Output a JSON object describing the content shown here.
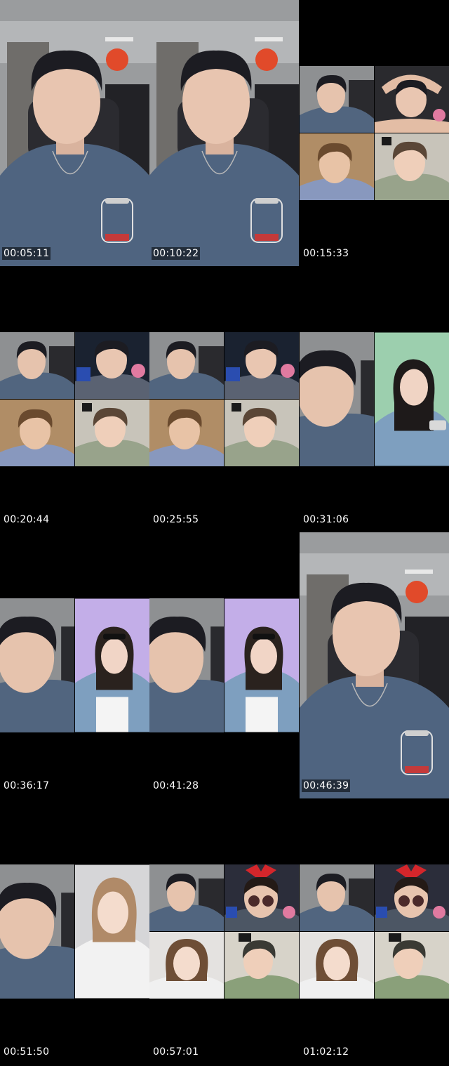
{
  "timestamps": [
    "00:05:11",
    "00:10:22",
    "00:15:33",
    "00:20:44",
    "00:25:55",
    "00:31:06",
    "00:36:17",
    "00:41:28",
    "00:46:39",
    "00:51:50",
    "00:57:01",
    "01:02:12"
  ],
  "colors": {
    "background": "#000000",
    "room_wall": "#9a9c9e",
    "shirt_blue": "#4f6480",
    "skin": "#e8c5b0",
    "hair": "#1c1c22",
    "hoodie_green": "#98a38b",
    "pink_bg": "#c3aee8",
    "green_bg": "#9ccfae"
  }
}
